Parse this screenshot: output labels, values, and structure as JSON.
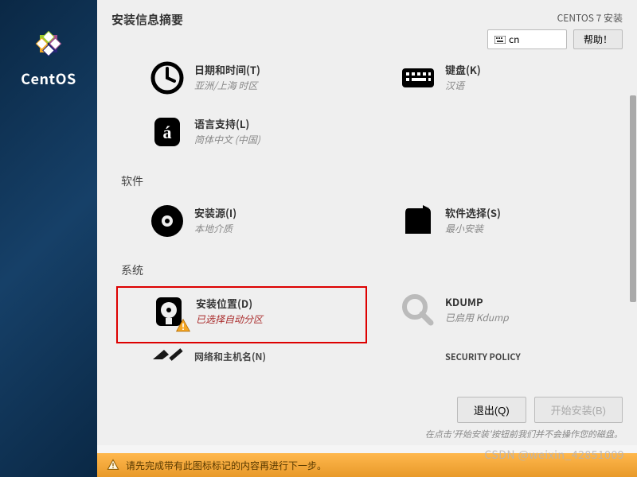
{
  "header": {
    "title": "安装信息摘要",
    "subtitle": "CENTOS 7 安装",
    "keyboard_layout": "cn",
    "help_label": "帮助！"
  },
  "brand": "CentOS",
  "sections": [
    {
      "label": "",
      "items": [
        {
          "icon": "clock",
          "title": "日期和时间(T)",
          "status": "亚洲/上海 时区",
          "warn": false
        },
        {
          "icon": "keyboard",
          "title": "键盘(K)",
          "status": "汉语",
          "warn": false
        },
        {
          "icon": "language",
          "title": "语言支持(L)",
          "status": "简体中文 (中国)",
          "warn": false
        }
      ]
    },
    {
      "label": "软件",
      "items": [
        {
          "icon": "disc",
          "title": "安装源(I)",
          "status": "本地介质",
          "warn": false
        },
        {
          "icon": "package",
          "title": "软件选择(S)",
          "status": "最小安装",
          "warn": false
        }
      ]
    },
    {
      "label": "系统",
      "items": [
        {
          "icon": "disk",
          "title": "安装位置(D)",
          "status": "已选择自动分区",
          "warn": true,
          "highlight": true
        },
        {
          "icon": "kdump",
          "title": "KDUMP",
          "status": "已启用 Kdump",
          "warn": false
        },
        {
          "icon": "network",
          "title": "网络和主机名(N)",
          "status": "",
          "warn": false,
          "partial": true
        },
        {
          "icon": "security",
          "title": "SECURITY POLICY",
          "status": "",
          "warn": false,
          "partial": true
        }
      ]
    }
  ],
  "footer": {
    "quit_label": "退出(Q)",
    "begin_label": "开始安装(B)",
    "hint": "在点击'开始安装'按钮前我们并不会操作您的磁盘。"
  },
  "warning_bar": "请先完成带有此图标标记的内容再进行下一步。",
  "watermark": "CSDN @weixin_42851009"
}
